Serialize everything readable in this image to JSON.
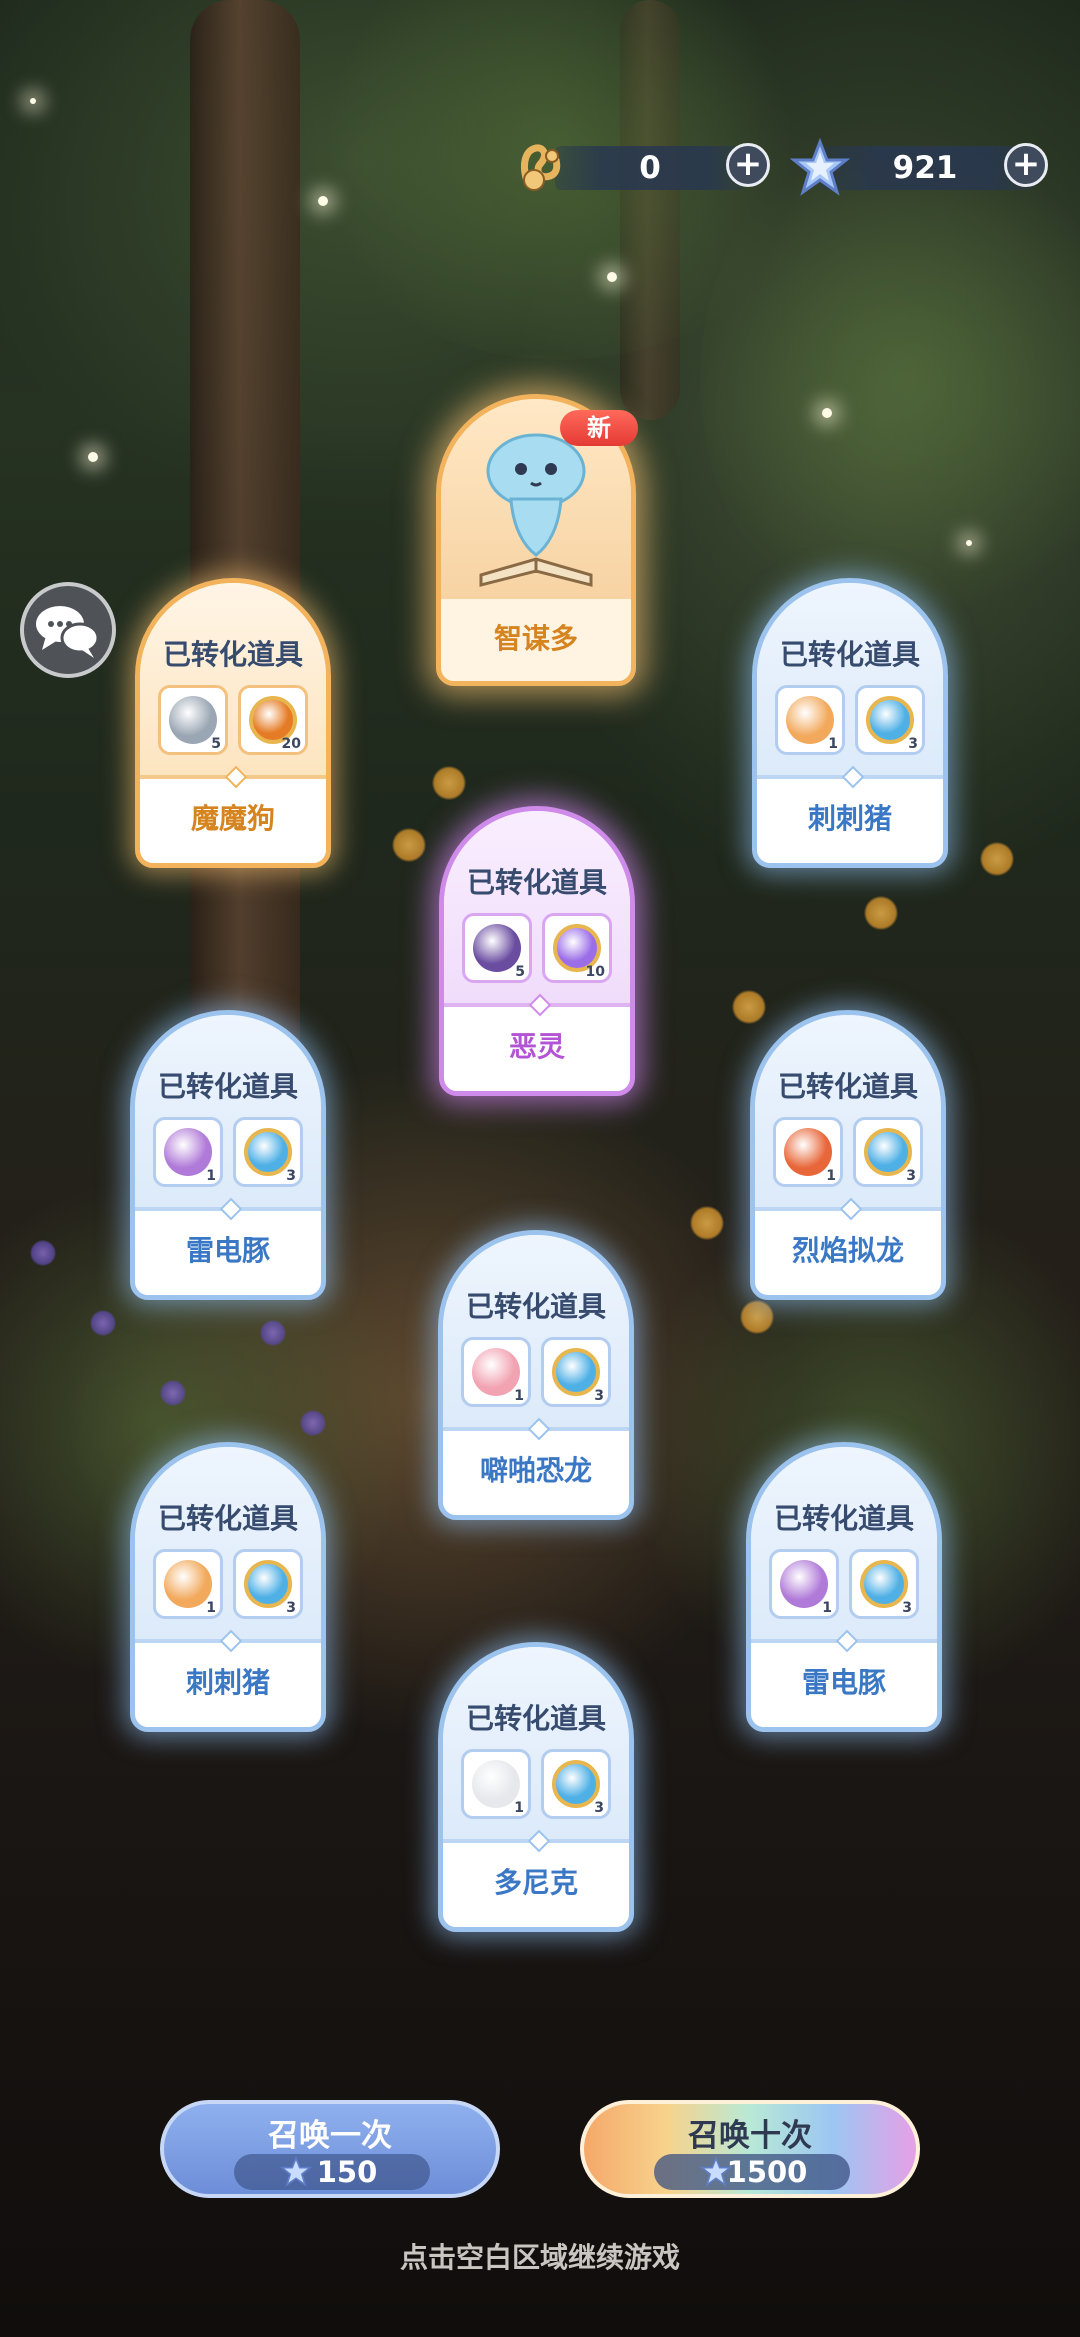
{
  "currencies": {
    "coins": {
      "icon": "horseshoe-coin-icon",
      "value": "0"
    },
    "stars": {
      "icon": "crystal-star-icon",
      "value": "921"
    }
  },
  "featured": {
    "badge": "新",
    "name": "智谋多",
    "icon": "ghost-book-icon"
  },
  "card_title": "已转化道具",
  "cards": [
    {
      "name": "魔魔狗",
      "theme": "orange",
      "left_item": {
        "icon": "gray-creature-icon",
        "count": "5"
      },
      "right_item": {
        "icon": "orange-orb-token-icon",
        "count": "20"
      }
    },
    {
      "name": "刺刺猪",
      "theme": "blue",
      "left_item": {
        "icon": "orange-hedgehog-icon",
        "count": "1"
      },
      "right_item": {
        "icon": "blue-orb-token-icon",
        "count": "3"
      }
    },
    {
      "name": "恶灵",
      "theme": "purple",
      "left_item": {
        "icon": "purple-ghost-icon",
        "count": "5"
      },
      "right_item": {
        "icon": "purple-orb-token-icon",
        "count": "10"
      }
    },
    {
      "name": "雷电豚",
      "theme": "blue",
      "left_item": {
        "icon": "purple-dolphin-icon",
        "count": "1"
      },
      "right_item": {
        "icon": "blue-orb-token-icon",
        "count": "3"
      }
    },
    {
      "name": "烈焰拟龙",
      "theme": "blue",
      "left_item": {
        "icon": "red-dragon-icon",
        "count": "1"
      },
      "right_item": {
        "icon": "blue-orb-token-icon",
        "count": "3"
      }
    },
    {
      "name": "噼啪恐龙",
      "theme": "blue",
      "left_item": {
        "icon": "pink-dino-icon",
        "count": "1"
      },
      "right_item": {
        "icon": "blue-orb-token-icon",
        "count": "3"
      }
    },
    {
      "name": "刺刺猪",
      "theme": "blue",
      "left_item": {
        "icon": "orange-hedgehog-icon",
        "count": "1"
      },
      "right_item": {
        "icon": "blue-orb-token-icon",
        "count": "3"
      }
    },
    {
      "name": "雷电豚",
      "theme": "blue",
      "left_item": {
        "icon": "purple-dolphin-icon",
        "count": "1"
      },
      "right_item": {
        "icon": "blue-orb-token-icon",
        "count": "3"
      }
    },
    {
      "name": "多尼克",
      "theme": "blue",
      "left_item": {
        "icon": "white-cat-icon",
        "count": "1"
      },
      "right_item": {
        "icon": "blue-orb-token-icon",
        "count": "3"
      }
    }
  ],
  "summon_once": {
    "label": "召唤一次",
    "cost": "150"
  },
  "summon_ten": {
    "label": "召唤十次",
    "cost": "1500"
  },
  "hint": "点击空白区域继续游戏",
  "colors": {
    "blue_border": "#9cc3ee",
    "orange_border": "#f2b35c",
    "purple_border": "#cf8bea",
    "name_blue": "#3a78c6",
    "name_orange": "#d58420",
    "name_purple": "#b353d6"
  }
}
